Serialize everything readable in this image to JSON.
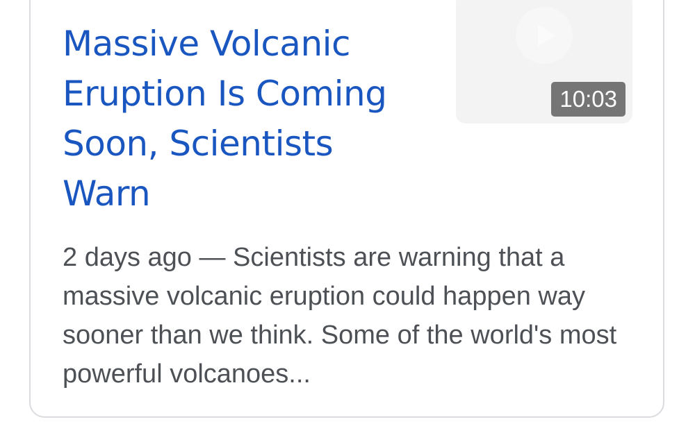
{
  "result": {
    "title": "Massive Volcanic Eruption Is Coming Soon, Scientists Warn",
    "date": "2 days ago",
    "separator": " — ",
    "snippet": "Scientists are warning that a massive volcanic eruption could happen way sooner than we think. Some of the world's most powerful volcanoes...",
    "video": {
      "duration": "10:03",
      "icon": "play-icon"
    }
  },
  "colors": {
    "title": "#1a56c0",
    "snippet": "#4d5156",
    "border": "#dadce0",
    "duration_badge": "#757575"
  }
}
